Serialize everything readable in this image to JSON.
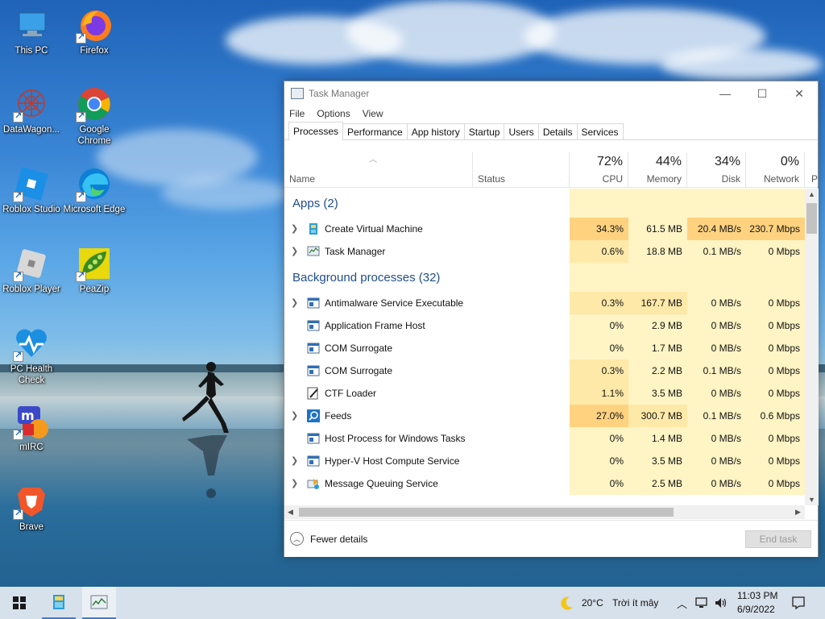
{
  "desktop": {
    "icons": [
      {
        "label": "This PC",
        "icon": "this-pc-icon"
      },
      {
        "label": "Firefox",
        "icon": "firefox-icon"
      },
      {
        "label": "DataWagon...",
        "icon": "datawagon-icon"
      },
      {
        "label": "Google Chrome",
        "icon": "chrome-icon"
      },
      {
        "label": "Roblox Studio",
        "icon": "roblox-studio-icon"
      },
      {
        "label": "Microsoft Edge",
        "icon": "edge-icon"
      },
      {
        "label": "Roblox Player",
        "icon": "roblox-player-icon"
      },
      {
        "label": "PeaZip",
        "icon": "peazip-icon"
      },
      {
        "label": "PC Health Check",
        "icon": "pc-health-check-icon"
      },
      {
        "label": "mIRC",
        "icon": "mirc-icon"
      },
      {
        "label": "Brave",
        "icon": "brave-icon"
      }
    ]
  },
  "window": {
    "title": "Task Manager",
    "menu": [
      "File",
      "Options",
      "View"
    ],
    "tabs": [
      "Processes",
      "Performance",
      "App history",
      "Startup",
      "Users",
      "Details",
      "Services"
    ],
    "active_tab": "Processes"
  },
  "columns": {
    "name": "Name",
    "status": "Status",
    "cpu": {
      "pct": "72%",
      "label": "CPU"
    },
    "memory": {
      "pct": "44%",
      "label": "Memory"
    },
    "disk": {
      "pct": "34%",
      "label": "Disk"
    },
    "network": {
      "pct": "0%",
      "label": "Network"
    },
    "power_partial": "P"
  },
  "groups": {
    "apps": "Apps (2)",
    "background": "Background processes (32)"
  },
  "apps": [
    {
      "name": "Create Virtual Machine",
      "cpu": "34.3%",
      "mem": "61.5 MB",
      "disk": "20.4 MB/s",
      "net": "230.7 Mbps",
      "expand": true,
      "icon": "vm-app-icon"
    },
    {
      "name": "Task Manager",
      "cpu": "0.6%",
      "mem": "18.8 MB",
      "disk": "0.1 MB/s",
      "net": "0 Mbps",
      "expand": true,
      "icon": "task-manager-icon"
    }
  ],
  "background": [
    {
      "name": "Antimalware Service Executable",
      "cpu": "0.3%",
      "mem": "167.7 MB",
      "disk": "0 MB/s",
      "net": "0 Mbps",
      "expand": true,
      "icon": "service-window-icon"
    },
    {
      "name": "Application Frame Host",
      "cpu": "0%",
      "mem": "2.9 MB",
      "disk": "0 MB/s",
      "net": "0 Mbps",
      "expand": false,
      "icon": "service-window-icon"
    },
    {
      "name": "COM Surrogate",
      "cpu": "0%",
      "mem": "1.7 MB",
      "disk": "0 MB/s",
      "net": "0 Mbps",
      "expand": false,
      "icon": "service-window-icon"
    },
    {
      "name": "COM Surrogate",
      "cpu": "0.3%",
      "mem": "2.2 MB",
      "disk": "0.1 MB/s",
      "net": "0 Mbps",
      "expand": false,
      "icon": "service-window-icon"
    },
    {
      "name": "CTF Loader",
      "cpu": "1.1%",
      "mem": "3.5 MB",
      "disk": "0 MB/s",
      "net": "0 Mbps",
      "expand": false,
      "icon": "ctf-loader-icon"
    },
    {
      "name": "Feeds",
      "cpu": "27.0%",
      "mem": "300.7 MB",
      "disk": "0.1 MB/s",
      "net": "0.6 Mbps",
      "expand": true,
      "icon": "feeds-search-icon"
    },
    {
      "name": "Host Process for Windows Tasks",
      "cpu": "0%",
      "mem": "1.4 MB",
      "disk": "0 MB/s",
      "net": "0 Mbps",
      "expand": false,
      "icon": "service-window-icon"
    },
    {
      "name": "Hyper-V Host Compute Service",
      "cpu": "0%",
      "mem": "3.5 MB",
      "disk": "0 MB/s",
      "net": "0 Mbps",
      "expand": true,
      "icon": "service-window-icon"
    },
    {
      "name": "Message Queuing Service",
      "cpu": "0%",
      "mem": "2.5 MB",
      "disk": "0 MB/s",
      "net": "0 Mbps",
      "expand": true,
      "icon": "message-queuing-icon"
    }
  ],
  "footer": {
    "fewer_details": "Fewer details",
    "end_task": "End task"
  },
  "taskbar": {
    "weather_temp": "20°C",
    "weather_text": "Trời ít mây",
    "time": "11:03 PM",
    "date": "6/9/2022"
  },
  "colors": {
    "heat_low": "#fff4c4",
    "heat_mid": "#ffe9a8",
    "heat_high": "#ffd280",
    "group_title": "#1f4e8c"
  }
}
